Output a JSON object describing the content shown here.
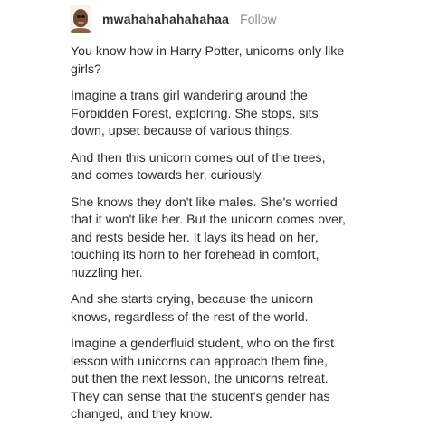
{
  "post": {
    "username": "mwahahahahahahaa",
    "follow_label": "Follow",
    "avatar_icon": "user-avatar-icon",
    "paragraphs": [
      "You know how in Harry Potter, unicorns only like\ngirls?",
      "Imagine a trans girl wandering around the\nForbidden Forest, exploring. She stops, sits\ndown, upset because of various things.",
      "And then this unicorn comes out of the trees,\nand comes towards her, curiously.",
      "She knows they don't like males. She's worried\nthat it won't like her. But the unicorn comes over,\nand rests beside her. It lays its head on her,\ntouching its horn to her forehead in comfort,\nnuzzling her.",
      "And she starts crying, because the unicorn\nknows, regardless of the rest of the world.",
      "Imagine a genderfluid student, who on the first\nlesson with unicorns can approach them fine,\nbut then the next lesson, the unicorns retreat.\nThey can sense that the student's gender has\nchanged, and they know."
    ]
  }
}
